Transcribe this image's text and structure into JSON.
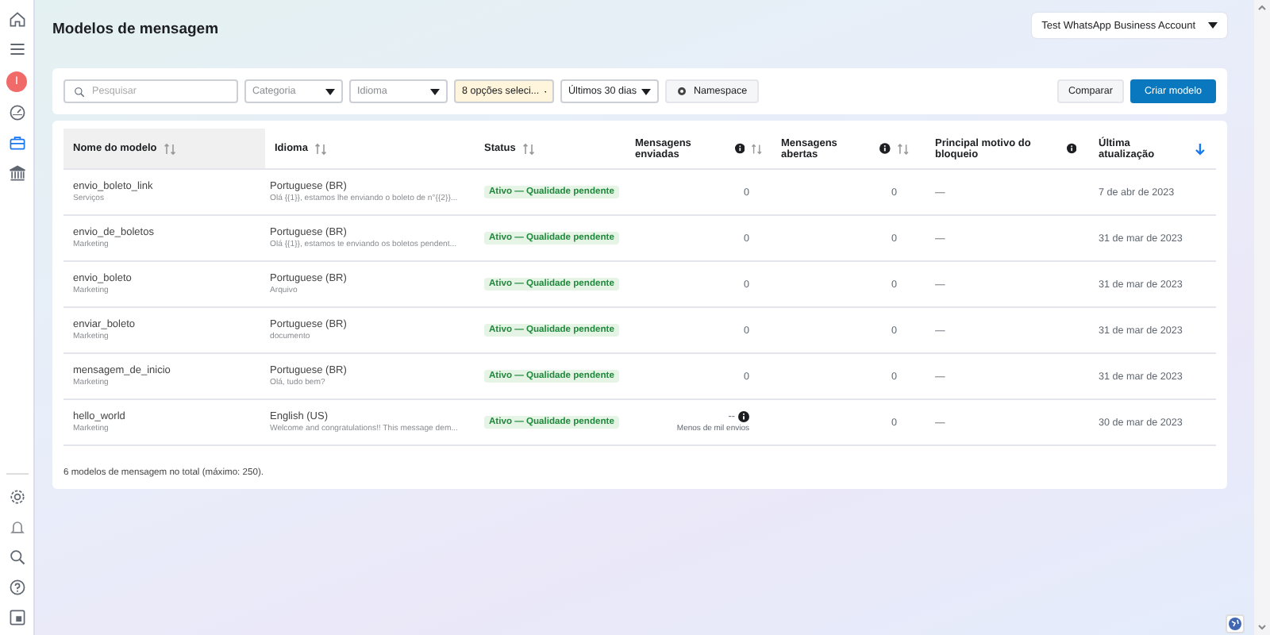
{
  "sidebar": {
    "avatar": "I",
    "items": [
      {
        "selected": false
      },
      {
        "selected": false
      },
      {
        "selected": false
      },
      {
        "selected": true
      },
      {
        "selected": false
      }
    ]
  },
  "header": {
    "title": "Modelos de mensagem",
    "account": "Test WhatsApp Business Account"
  },
  "toolbar": {
    "search": {
      "placeholder": "Pesquisar"
    },
    "filters": [
      {
        "placeholder": "Categoria",
        "active": false
      },
      {
        "placeholder": "Idioma",
        "active": false
      },
      {
        "value": "8 opções seleci...",
        "active": true
      },
      {
        "value": "Últimos 30 dias",
        "active": false
      }
    ],
    "namespace_button": "Namespace",
    "compare_button": "Comparar",
    "create_button": "Criar modelo"
  },
  "table": {
    "columns": [
      {
        "label": "Nome do modelo",
        "info": false,
        "sortable": true,
        "sorted": false,
        "highlighted": true
      },
      {
        "label": "Idioma",
        "info": false,
        "sortable": true,
        "sorted": false,
        "highlighted": false
      },
      {
        "label": "Status",
        "info": false,
        "sortable": true,
        "sorted": false,
        "highlighted": false
      },
      {
        "label": "Mensagens enviadas",
        "info": true,
        "sortable": true,
        "sorted": false,
        "highlighted": false
      },
      {
        "label": "Mensagens abertas",
        "info": true,
        "sortable": true,
        "sorted": false,
        "highlighted": false
      },
      {
        "label": "Principal motivo do bloqueio",
        "info": true,
        "sortable": false,
        "highlighted": false
      },
      {
        "label": "Última atualização",
        "info": false,
        "sortable": true,
        "sorted": true,
        "highlighted": false
      }
    ],
    "rows": [
      {
        "name": "envio_boleto_link",
        "category": "Serviços",
        "language": "Portuguese (BR)",
        "preview": "Olá {{1}}, estamos lhe enviando o boleto de n°{{2}}...",
        "status": "Ativo — Qualidade pendente",
        "sent": "0",
        "sent_info": false,
        "opened": "0",
        "block_reason": "—",
        "updated": "7 de abr de 2023"
      },
      {
        "name": "envio_de_boletos",
        "category": "Marketing",
        "language": "Portuguese (BR)",
        "preview": "Olá {{1}}, estamos te enviando os boletos pendent...",
        "status": "Ativo — Qualidade pendente",
        "sent": "0",
        "sent_info": false,
        "opened": "0",
        "block_reason": "—",
        "updated": "31 de mar de 2023"
      },
      {
        "name": "envio_boleto",
        "category": "Marketing",
        "language": "Portuguese (BR)",
        "preview": "Arquivo",
        "status": "Ativo — Qualidade pendente",
        "sent": "0",
        "sent_info": false,
        "opened": "0",
        "block_reason": "—",
        "updated": "31 de mar de 2023"
      },
      {
        "name": "enviar_boleto",
        "category": "Marketing",
        "language": "Portuguese (BR)",
        "preview": "documento",
        "status": "Ativo — Qualidade pendente",
        "sent": "0",
        "sent_info": false,
        "opened": "0",
        "block_reason": "—",
        "updated": "31 de mar de 2023"
      },
      {
        "name": "mensagem_de_inicio",
        "category": "Marketing",
        "language": "Portuguese (BR)",
        "preview": "Olá, tudo bem?",
        "status": "Ativo — Qualidade pendente",
        "sent": "0",
        "sent_info": false,
        "opened": "0",
        "block_reason": "—",
        "updated": "31 de mar de 2023"
      },
      {
        "name": "hello_world",
        "category": "Marketing",
        "language": "English (US)",
        "preview": "Welcome and congratulations!! This message dem...",
        "status": "Ativo — Qualidade pendente",
        "sent": "--",
        "sent_info": true,
        "sent_note": "Menos de mil envios",
        "opened": "0",
        "block_reason": "—",
        "updated": "30 de mar de 2023"
      }
    ],
    "footer": "6 modelos de mensagem no total (máximo: 250)."
  }
}
